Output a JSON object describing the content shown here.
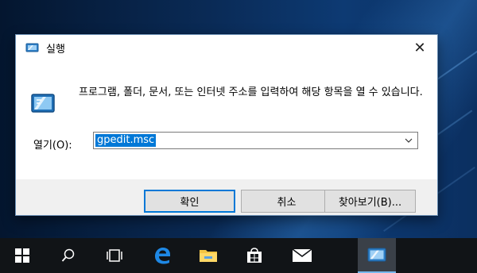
{
  "dialog": {
    "title": "실행",
    "icon": "run-icon",
    "close_icon": "close-icon",
    "close_glyph": "✕",
    "description": "프로그램, 폴더, 문서, 또는 인터넷 주소를 입력하여 해당 항목을 열 수 있습니다.",
    "open_label": "열기(O):",
    "open_value": "gpedit.msc",
    "dropdown_icon": "chevron-down-icon",
    "buttons": {
      "ok": "확인",
      "cancel": "취소",
      "browse": "찾아보기(B)..."
    }
  },
  "taskbar": {
    "items": [
      {
        "name": "start",
        "icon": "windows-logo-icon"
      },
      {
        "name": "search",
        "icon": "search-icon"
      },
      {
        "name": "task-view",
        "icon": "task-view-icon"
      },
      {
        "name": "edge",
        "icon": "edge-icon"
      },
      {
        "name": "file-explorer",
        "icon": "folder-icon"
      },
      {
        "name": "store",
        "icon": "store-icon"
      },
      {
        "name": "mail",
        "icon": "mail-icon"
      },
      {
        "name": "run",
        "icon": "run-icon",
        "active": true
      }
    ]
  },
  "colors": {
    "accent": "#0078d7",
    "taskbar": "#111417",
    "dialog_bg": "#f0f0f0"
  }
}
